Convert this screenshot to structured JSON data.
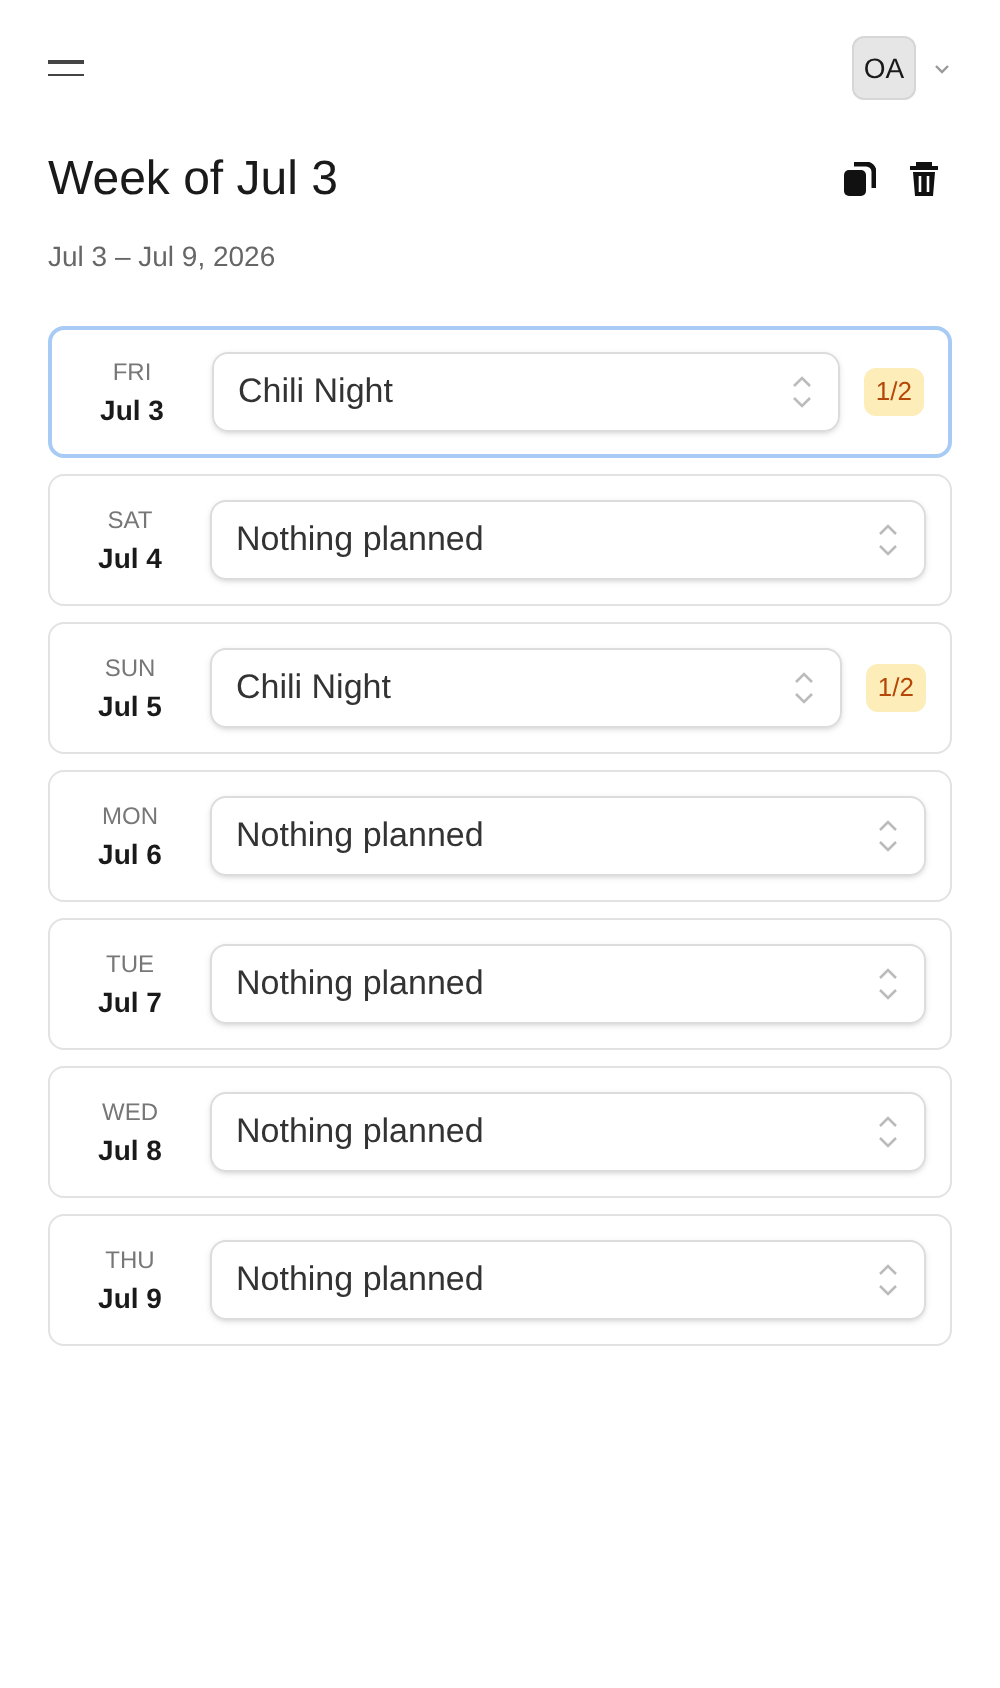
{
  "header": {
    "avatar": "OA"
  },
  "title": "Week of Jul 3",
  "subtitle": "Jul 3 – Jul 9, 2026",
  "days": [
    {
      "weekday": "FRI",
      "date": "Jul 3",
      "meal": "Chili Night",
      "badge": "1/2",
      "selected": true
    },
    {
      "weekday": "SAT",
      "date": "Jul 4",
      "meal": "Nothing planned",
      "selected": false
    },
    {
      "weekday": "SUN",
      "date": "Jul 5",
      "meal": "Chili Night",
      "badge": "1/2",
      "selected": false
    },
    {
      "weekday": "MON",
      "date": "Jul 6",
      "meal": "Nothing planned",
      "selected": false
    },
    {
      "weekday": "TUE",
      "date": "Jul 7",
      "meal": "Nothing planned",
      "selected": false
    },
    {
      "weekday": "WED",
      "date": "Jul 8",
      "meal": "Nothing planned",
      "selected": false
    },
    {
      "weekday": "THU",
      "date": "Jul 9",
      "meal": "Nothing planned",
      "selected": false
    }
  ]
}
